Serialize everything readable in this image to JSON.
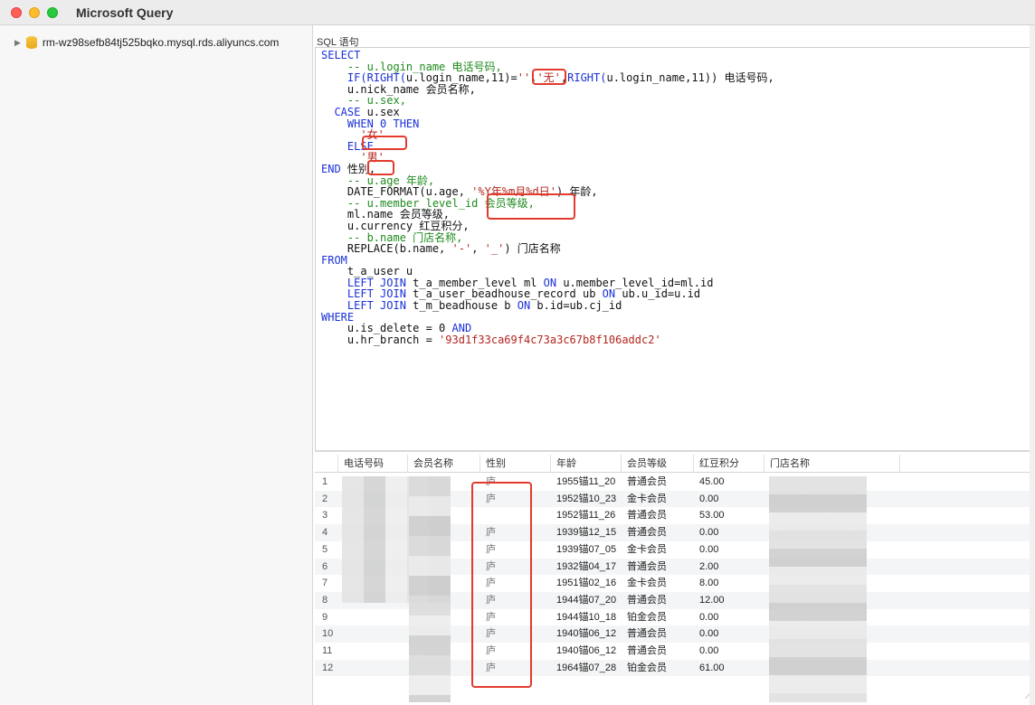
{
  "window": {
    "title": "Microsoft Query"
  },
  "sidebar": {
    "connection": "rm-wz98sefb84tj525bqko.mysql.rds.aliyuncs.com"
  },
  "editor": {
    "label": "SQL 语句",
    "lines": [
      [
        [
          "kw",
          "SELECT"
        ]
      ],
      [
        [
          "cm",
          "    -- u.login_name 电话号码,"
        ]
      ],
      [
        [
          "kw",
          "    IF(RIGHT("
        ],
        [
          "",
          "u.login_name,11)="
        ],
        [
          "st",
          "''"
        ],
        [
          "",
          ","
        ],
        [
          "st",
          "'无'"
        ],
        [
          "",
          ","
        ],
        [
          "kw",
          "RIGHT("
        ],
        [
          "",
          "u.login_name,11)) 电话号码,"
        ]
      ],
      [
        [
          "",
          "    u.nick_name 会员名称,"
        ]
      ],
      [
        [
          "cm",
          "    -- u.sex,"
        ]
      ],
      [
        [
          "kw",
          "  CASE"
        ],
        [
          "",
          " u.sex"
        ]
      ],
      [
        [
          "kw",
          "    WHEN 0 THEN"
        ]
      ],
      [
        [
          "st",
          "      '女'"
        ]
      ],
      [
        [
          "kw",
          "    ELSE"
        ]
      ],
      [
        [
          "st",
          "      '男'"
        ]
      ],
      [
        [
          "kw",
          "END"
        ],
        [
          "",
          " 性别,"
        ]
      ],
      [
        [
          "cm",
          "    -- u.age 年龄,"
        ]
      ],
      [
        [
          "",
          "    DATE_FORMAT(u.age, "
        ],
        [
          "st",
          "'%Y年%m月%d日'"
        ],
        [
          "",
          ") 年龄,"
        ]
      ],
      [
        [
          "cm",
          "    -- u.member_level_id 会员等级,"
        ]
      ],
      [
        [
          "",
          "    ml.name 会员等级,"
        ]
      ],
      [
        [
          "",
          "    u.currency 红豆积分,"
        ]
      ],
      [
        [
          "cm",
          "    -- b.name 门店名称,"
        ]
      ],
      [
        [
          "",
          "    REPLACE(b.name, "
        ],
        [
          "st",
          "'-'"
        ],
        [
          "",
          ", "
        ],
        [
          "st",
          "'_'"
        ],
        [
          "",
          ") 门店名称"
        ]
      ],
      [
        [
          "kw",
          "FROM"
        ]
      ],
      [
        [
          "",
          "    t_a_user u"
        ]
      ],
      [
        [
          "kw",
          "    LEFT JOIN"
        ],
        [
          "",
          " t_a_member_level ml "
        ],
        [
          "kw",
          "ON"
        ],
        [
          "",
          " u.member_level_id=ml.id"
        ]
      ],
      [
        [
          "kw",
          "    LEFT JOIN"
        ],
        [
          "",
          " t_a_user_beadhouse_record ub "
        ],
        [
          "kw",
          "ON"
        ],
        [
          "",
          " ub.u_id=u.id"
        ]
      ],
      [
        [
          "kw",
          "    LEFT JOIN"
        ],
        [
          "",
          " t_m_beadhouse b "
        ],
        [
          "kw",
          "ON"
        ],
        [
          "",
          " b.id=ub.cj_id"
        ]
      ],
      [
        [
          "kw",
          "WHERE"
        ]
      ],
      [
        [
          "",
          "    u.is_delete = 0 "
        ],
        [
          "kw",
          "AND"
        ]
      ],
      [
        [
          "",
          "    u.hr_branch = "
        ],
        [
          "st",
          "'93d1f33ca69f4c73a3c67b8f106addc2'"
        ]
      ]
    ]
  },
  "grid": {
    "columns": [
      "电话号码",
      "会员名称",
      "性别",
      "年龄",
      "会员等级",
      "红豆积分",
      "门店名称"
    ],
    "rows": [
      {
        "n": "1",
        "sex": "庐",
        "age": "1955锚11_20",
        "level": "普通会员",
        "points": "45.00"
      },
      {
        "n": "2",
        "sex": "庐",
        "age": "1952锚10_23",
        "level": "金卡会员",
        "points": "0.00"
      },
      {
        "n": "3",
        "sex": "",
        "age": "1952锚11_26",
        "level": "普通会员",
        "points": "53.00"
      },
      {
        "n": "4",
        "sex": "庐",
        "age": "1939锚12_15",
        "level": "普通会员",
        "points": "0.00"
      },
      {
        "n": "5",
        "sex": "庐",
        "age": "1939锚07_05",
        "level": "金卡会员",
        "points": "0.00"
      },
      {
        "n": "6",
        "sex": "庐",
        "age": "1932锚04_17",
        "level": "普通会员",
        "points": "2.00"
      },
      {
        "n": "7",
        "sex": "庐",
        "age": "1951锚02_16",
        "level": "金卡会员",
        "points": "8.00"
      },
      {
        "n": "8",
        "sex": "庐",
        "age": "1944锚07_20",
        "level": "普通会员",
        "points": "12.00"
      },
      {
        "n": "9",
        "sex": "庐",
        "age": "1944锚10_18",
        "level": "铂金会员",
        "points": "0.00"
      },
      {
        "n": "10",
        "sex": "庐",
        "age": "1940锚06_12",
        "level": "普通会员",
        "points": "0.00"
      },
      {
        "n": "11",
        "sex": "庐",
        "age": "1940锚06_12",
        "level": "普通会员",
        "points": "0.00"
      },
      {
        "n": "12",
        "sex": "庐",
        "age": "1964锚07_28",
        "level": "铂金会员",
        "points": "61.00"
      }
    ]
  },
  "colors": {
    "keyword": "#1a31d6",
    "comment": "#1e8a1e",
    "string": "#b3261e",
    "annotation": "#e23b2e"
  }
}
